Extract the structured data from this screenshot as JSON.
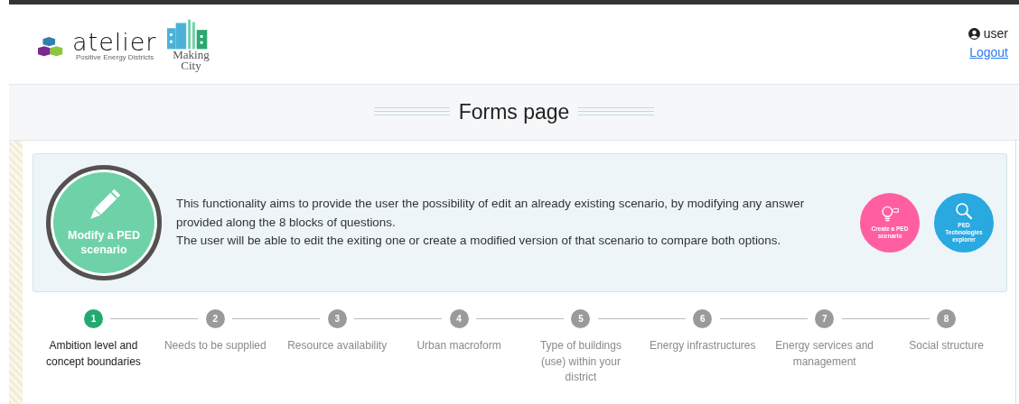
{
  "header": {
    "logo": {
      "name": "atelier",
      "tagline": "Positive Energy Districts"
    },
    "partner_logo": {
      "lines": [
        "Making",
        "City"
      ]
    },
    "user": {
      "name": "user",
      "logout": "Logout"
    }
  },
  "page_title": "Forms page",
  "intro": {
    "main_action": {
      "label": "Modify a PED scenario"
    },
    "paragraph_lines": [
      "This functionality aims to provide the user the possibility of edit an already existing scenario, by modifying any answer",
      "provided along the 8 blocks of questions.",
      "The user will be able to edit the exiting one or create a modified version of that scenario to compare both options."
    ],
    "actions": [
      {
        "label": "Create a PED scenario",
        "kind": "bulb"
      },
      {
        "label": "PED Technologies explorer",
        "kind": "search"
      }
    ]
  },
  "steps": [
    {
      "number": "1",
      "label": "Ambition level and concept boundaries",
      "selected": true
    },
    {
      "number": "2",
      "label": "Needs to be supplied",
      "selected": false
    },
    {
      "number": "3",
      "label": "Resource availability",
      "selected": false
    },
    {
      "number": "4",
      "label": "Urban macroform",
      "selected": false
    },
    {
      "number": "5",
      "label": "Type of buildings (use) within your district",
      "selected": false
    },
    {
      "number": "6",
      "label": "Energy infrastructures",
      "selected": false
    },
    {
      "number": "7",
      "label": "Energy services and management",
      "selected": false
    },
    {
      "number": "8",
      "label": "Social structure",
      "selected": false
    }
  ]
}
